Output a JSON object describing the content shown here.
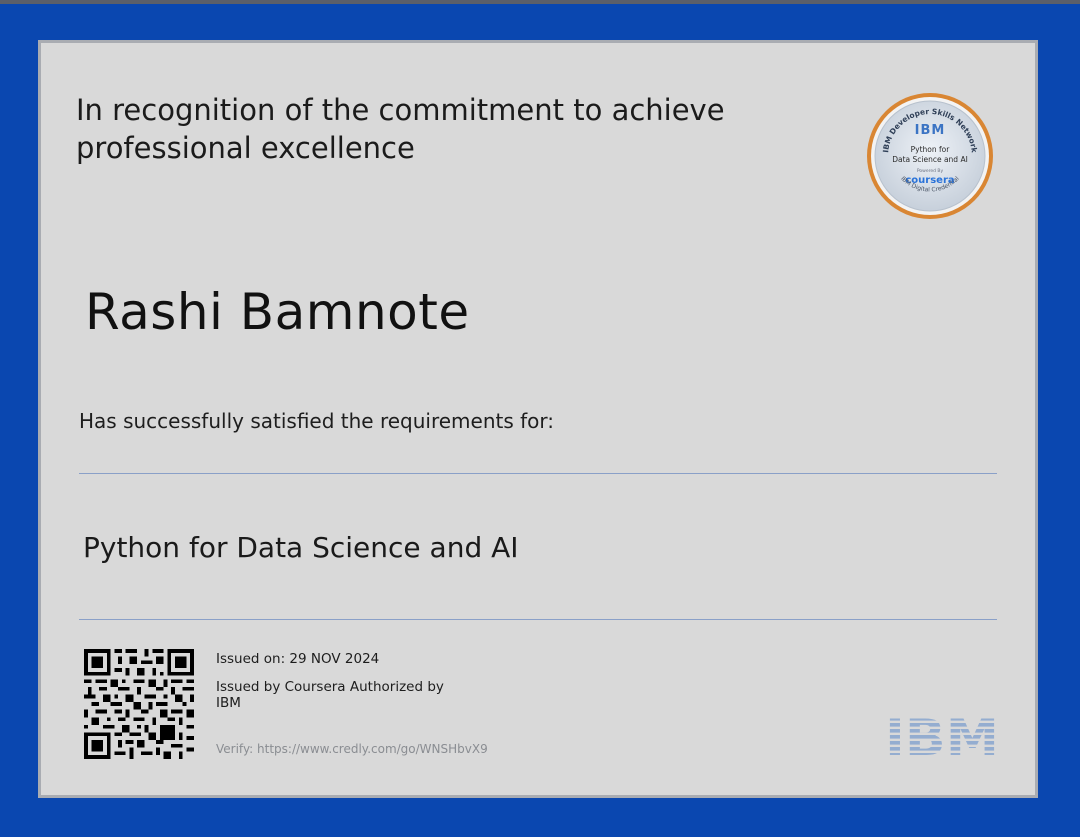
{
  "certificate": {
    "recognition_text": "In recognition of the commitment to achieve professional excellence",
    "recipient_name": "Rashi Bamnote",
    "requirements_text": "Has successfully satisfied the requirements for:",
    "course_title": "Python for Data Science and AI",
    "issued_on": "Issued on: 29 NOV 2024",
    "issued_by": "Issued by Coursera Authorized by IBM",
    "verify": "Verify: https://www.credly.com/go/WNSHbvX9"
  },
  "badge": {
    "ring_text": "IBM Developer Skills Network",
    "brand": "IBM",
    "course_line1": "Python for",
    "course_line2": "Data Science and AI",
    "powered_by": "Powered By",
    "partner": "coursera",
    "bottom_text": "IBM Digital Credential"
  },
  "logo": {
    "text": "IBM"
  },
  "colors": {
    "frame": "#0a47b0",
    "card": "#d9d9d9",
    "badge_ring": "#d98633",
    "ibm_blue": "#3b74c4",
    "rule": "#8aa0c8"
  }
}
